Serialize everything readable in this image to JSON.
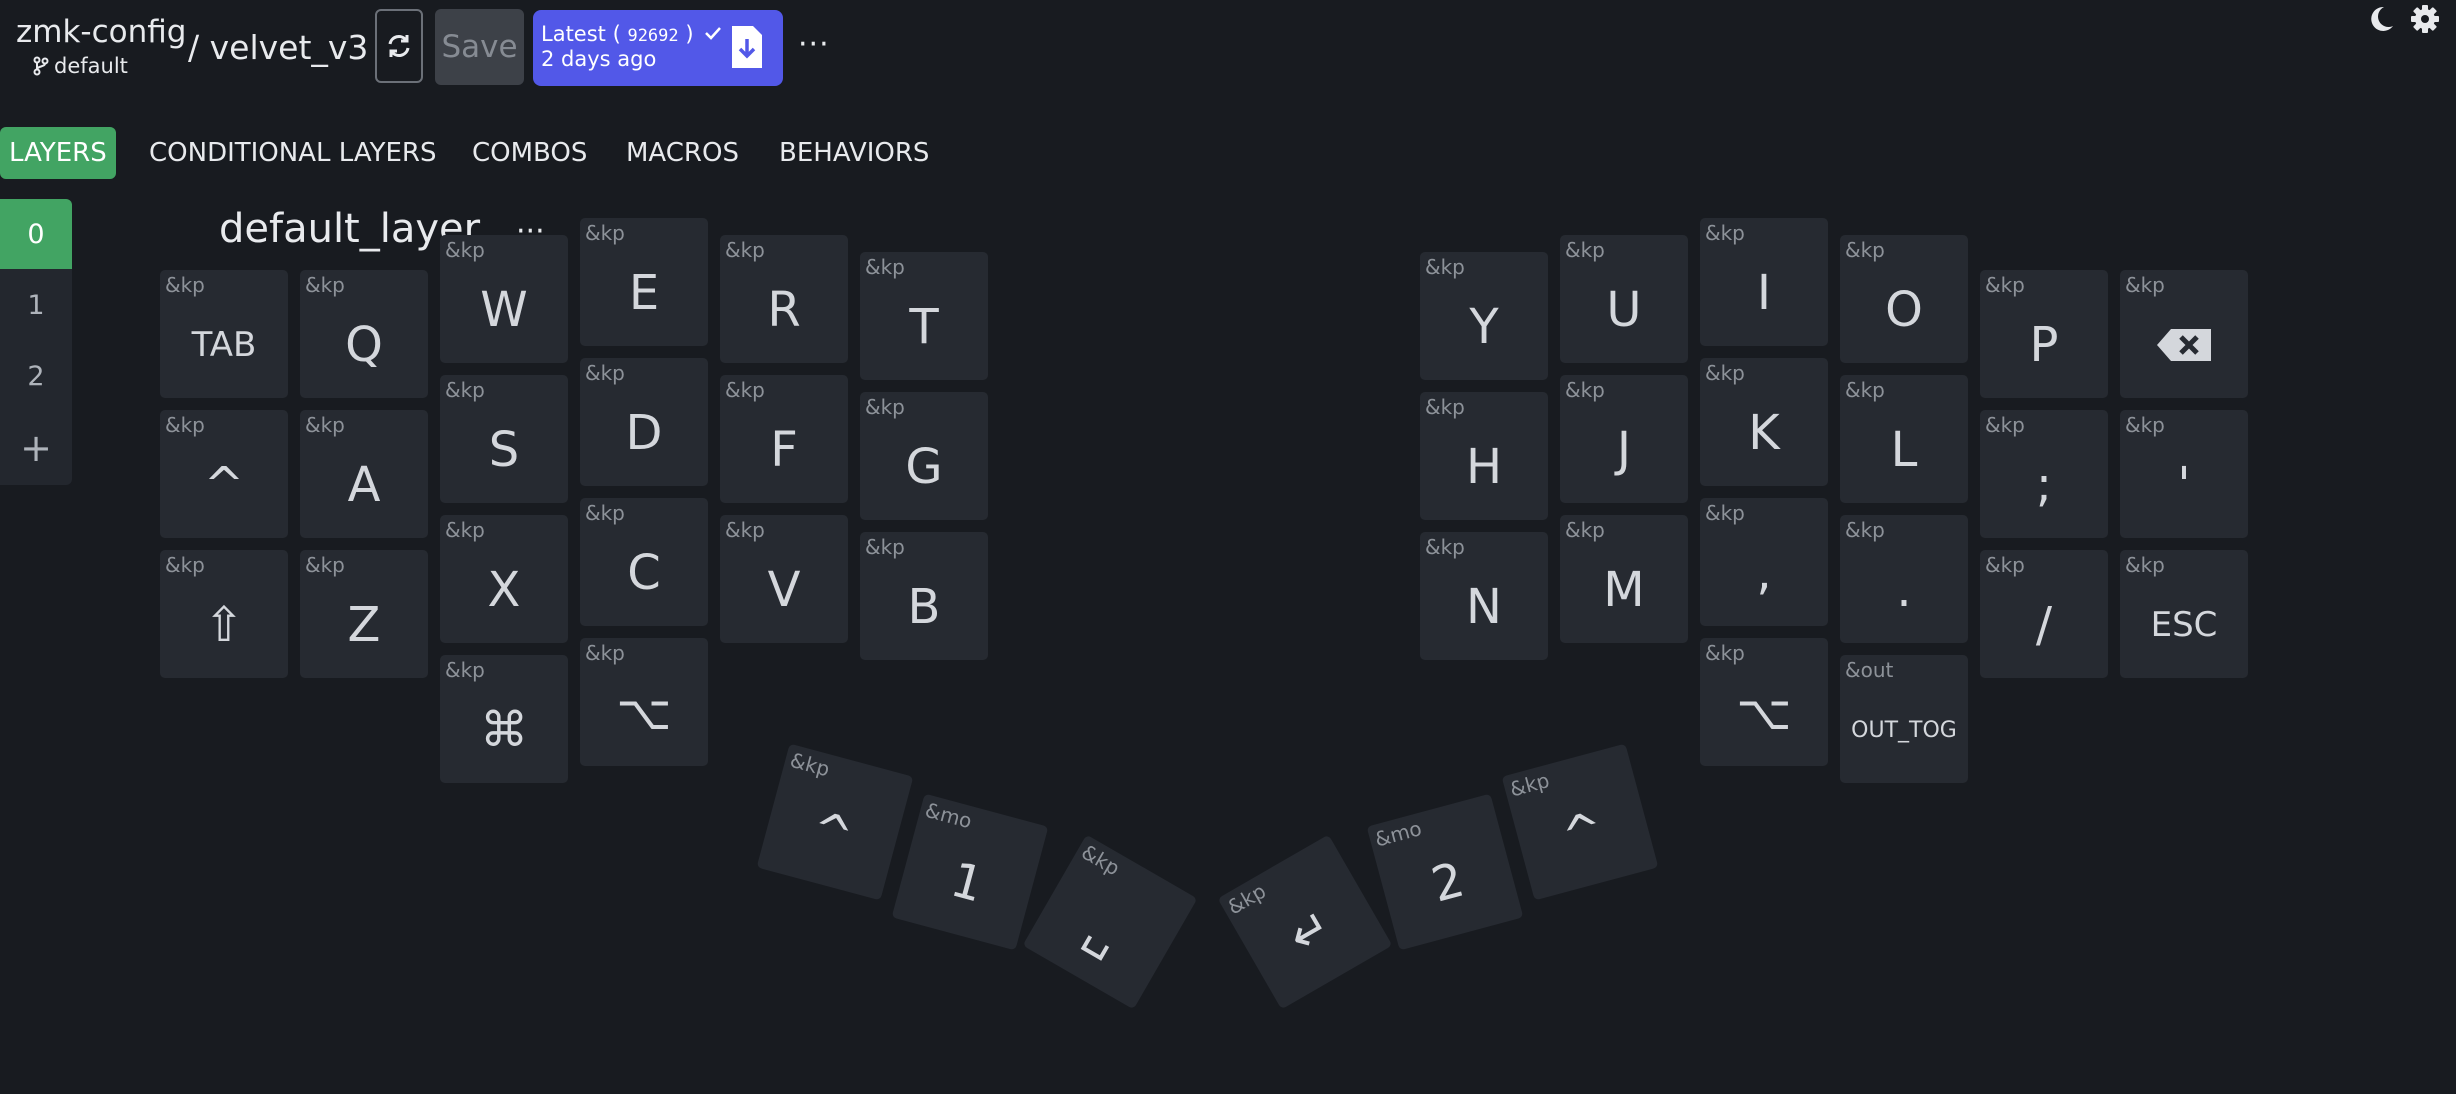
{
  "header": {
    "repo": "zmk-config",
    "branch": "default",
    "project_sep": "/ velvet_v3",
    "save_label": "Save",
    "release": {
      "label_prefix": "Latest (",
      "sha": "92692",
      "label_suffix": ")",
      "age": "2 days ago"
    },
    "more_label": "···"
  },
  "tabs": [
    {
      "label": "LAYERS",
      "active": true
    },
    {
      "label": "CONDITIONAL LAYERS"
    },
    {
      "label": "COMBOS"
    },
    {
      "label": "MACROS"
    },
    {
      "label": "BEHAVIORS"
    }
  ],
  "layers": [
    "0",
    "1",
    "2"
  ],
  "add_layer_label": "+",
  "layer_title": "default_layer",
  "layer_more": "···",
  "colors": {
    "accent_green": "#42a463",
    "release_blue": "#5258e8",
    "background": "#181b20",
    "key_bg": "#262a31"
  },
  "keys": [
    {
      "b": "&kp",
      "l": "TAB"
    },
    {
      "b": "&kp",
      "l": "Q"
    },
    {
      "b": "&kp",
      "l": "W"
    },
    {
      "b": "&kp",
      "l": "E"
    },
    {
      "b": "&kp",
      "l": "R"
    },
    {
      "b": "&kp",
      "l": "T"
    },
    {
      "b": "&kp",
      "l": "Y"
    },
    {
      "b": "&kp",
      "l": "U"
    },
    {
      "b": "&kp",
      "l": "I"
    },
    {
      "b": "&kp",
      "l": "O"
    },
    {
      "b": "&kp",
      "l": "P"
    },
    {
      "b": "&kp",
      "l": "",
      "icon": "backspace-icon"
    },
    {
      "b": "&kp",
      "l": "^"
    },
    {
      "b": "&kp",
      "l": "A"
    },
    {
      "b": "&kp",
      "l": "S"
    },
    {
      "b": "&kp",
      "l": "D"
    },
    {
      "b": "&kp",
      "l": "F"
    },
    {
      "b": "&kp",
      "l": "G"
    },
    {
      "b": "&kp",
      "l": "H"
    },
    {
      "b": "&kp",
      "l": "J"
    },
    {
      "b": "&kp",
      "l": "K"
    },
    {
      "b": "&kp",
      "l": "L"
    },
    {
      "b": "&kp",
      "l": ";"
    },
    {
      "b": "&kp",
      "l": "'"
    },
    {
      "b": "&kp",
      "l": "⇧"
    },
    {
      "b": "&kp",
      "l": "Z"
    },
    {
      "b": "&kp",
      "l": "X"
    },
    {
      "b": "&kp",
      "l": "C"
    },
    {
      "b": "&kp",
      "l": "V"
    },
    {
      "b": "&kp",
      "l": "B"
    },
    {
      "b": "&kp",
      "l": "N"
    },
    {
      "b": "&kp",
      "l": "M"
    },
    {
      "b": "&kp",
      "l": ","
    },
    {
      "b": "&kp",
      "l": "."
    },
    {
      "b": "&kp",
      "l": "/"
    },
    {
      "b": "&kp",
      "l": "ESC"
    },
    {
      "b": "&kp",
      "l": "⌘"
    },
    {
      "b": "&kp",
      "l": "⌥"
    },
    {
      "b": "&kp",
      "l": "⌥"
    },
    {
      "b": "&out",
      "l": "OUT_TOG"
    },
    {
      "b": "&kp",
      "l": "^"
    },
    {
      "b": "&mo",
      "l": "1"
    },
    {
      "b": "&kp",
      "l": "␣"
    },
    {
      "b": "&kp",
      "l": "↵"
    },
    {
      "b": "&mo",
      "l": "2"
    },
    {
      "b": "&kp",
      "l": "^"
    }
  ]
}
